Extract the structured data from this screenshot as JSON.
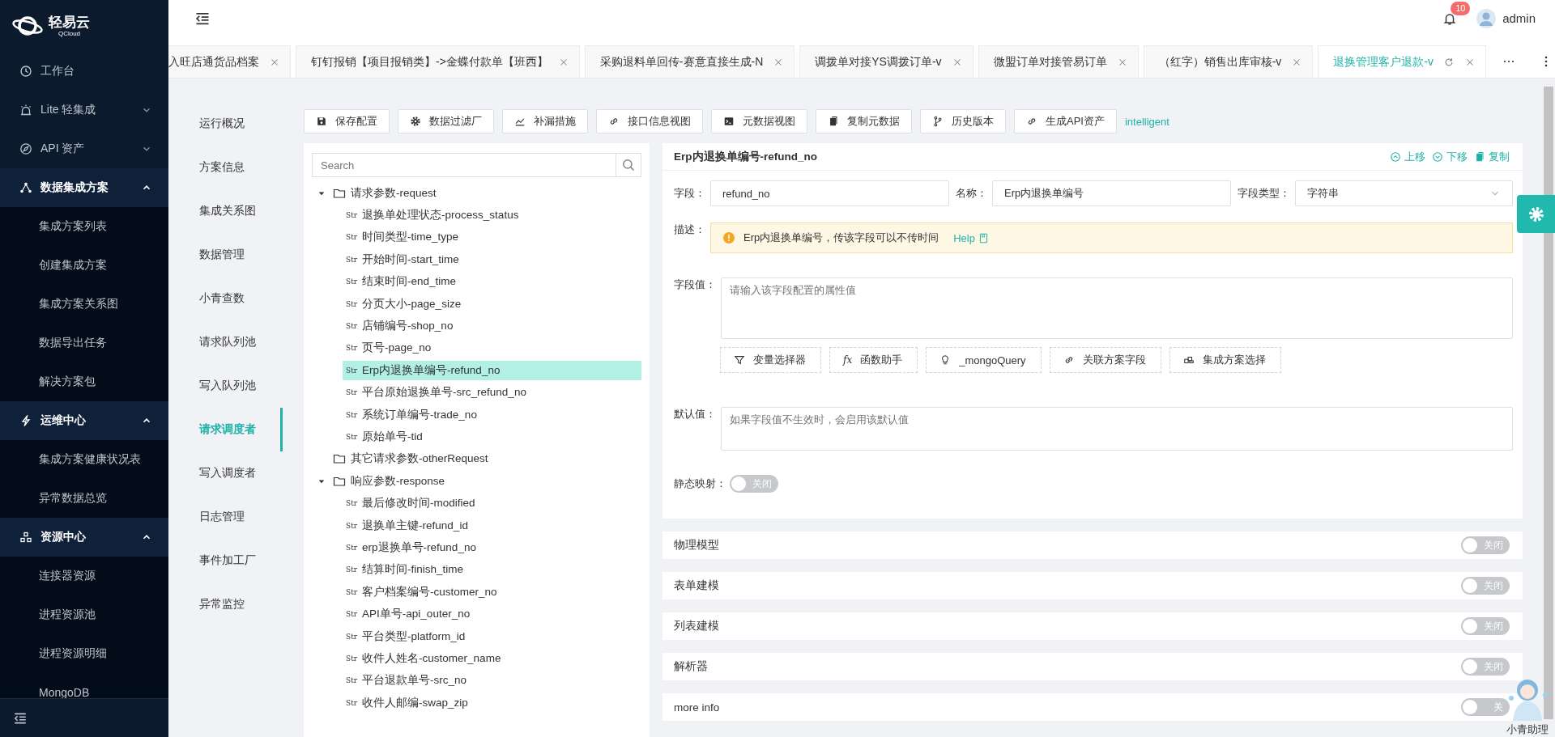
{
  "sidebar": {
    "logo": {
      "title": "轻易云",
      "subtitle": "QCloud"
    },
    "items": [
      {
        "label": "工作台"
      },
      {
        "label": "Lite 轻集成",
        "expanded": false
      },
      {
        "label": "API 资产",
        "expanded": false
      },
      {
        "label": "数据集成方案",
        "expanded": true,
        "children": [
          {
            "label": "集成方案列表"
          },
          {
            "label": "创建集成方案"
          },
          {
            "label": "集成方案关系图"
          },
          {
            "label": "数据导出任务"
          },
          {
            "label": "解决方案包"
          }
        ]
      },
      {
        "label": "运维中心",
        "expanded": true,
        "children": [
          {
            "label": "集成方案健康状况表"
          },
          {
            "label": "异常数据总览"
          }
        ]
      },
      {
        "label": "资源中心",
        "expanded": true,
        "children": [
          {
            "label": "连接器资源"
          },
          {
            "label": "进程资源池"
          },
          {
            "label": "进程资源明细"
          },
          {
            "label": "MongoDB"
          }
        ]
      }
    ]
  },
  "header": {
    "notification_count": "10",
    "user": "admin"
  },
  "tabs": [
    {
      "label": "入旺店通货品档案",
      "selected": false
    },
    {
      "label": "钉钉报销【项目报销类】->金蝶付款单【班西】",
      "selected": false
    },
    {
      "label": "采购退料单回传-赛意直接生成-N",
      "selected": false
    },
    {
      "label": "调拨单对接YS调拨订单-v",
      "selected": false
    },
    {
      "label": "微盟订单对接管易订单",
      "selected": false
    },
    {
      "label": "（红字）销售出库审核-v",
      "selected": false
    },
    {
      "label": "退换管理客户退款-v",
      "selected": true
    }
  ],
  "page_nav": [
    {
      "label": "运行概况",
      "selected": false
    },
    {
      "label": "方案信息",
      "selected": false
    },
    {
      "label": "集成关系图",
      "selected": false
    },
    {
      "label": "数据管理",
      "selected": false
    },
    {
      "label": "小青查数",
      "selected": false
    },
    {
      "label": "请求队列池",
      "selected": false
    },
    {
      "label": "写入队列池",
      "selected": false
    },
    {
      "label": "请求调度者",
      "selected": true
    },
    {
      "label": "写入调度者",
      "selected": false
    },
    {
      "label": "日志管理",
      "selected": false
    },
    {
      "label": "事件加工厂",
      "selected": false
    },
    {
      "label": "异常监控",
      "selected": false
    }
  ],
  "toolbar": {
    "buttons": [
      "保存配置",
      "数据过滤厂",
      "补漏措施",
      "接口信息视图",
      "元数据视图",
      "复制元数据",
      "历史版本",
      "生成API资产"
    ],
    "link": "intelligent"
  },
  "tree": {
    "search_placeholder": "Search",
    "nodes": [
      {
        "label": "请求参数-request",
        "expanded": true,
        "selected": false,
        "children": [
          {
            "type": "Str",
            "label": "退换单处理状态-process_status",
            "selected": false
          },
          {
            "type": "Str",
            "label": "时间类型-time_type",
            "selected": false
          },
          {
            "type": "Str",
            "label": "开始时间-start_time",
            "selected": false
          },
          {
            "type": "Str",
            "label": "结束时间-end_time",
            "selected": false
          },
          {
            "type": "Str",
            "label": "分页大小-page_size",
            "selected": false
          },
          {
            "type": "Str",
            "label": "店铺编号-shop_no",
            "selected": false
          },
          {
            "type": "Str",
            "label": "页号-page_no",
            "selected": false
          },
          {
            "type": "Str",
            "label": "Erp内退换单编号-refund_no",
            "selected": true
          },
          {
            "type": "Str",
            "label": "平台原始退换单号-src_refund_no",
            "selected": false
          },
          {
            "type": "Str",
            "label": "系统订单编号-trade_no",
            "selected": false
          },
          {
            "type": "Str",
            "label": "原始单号-tid",
            "selected": false
          }
        ]
      },
      {
        "label": "其它请求参数-otherRequest",
        "selected": false
      },
      {
        "label": "响应参数-response",
        "expanded": true,
        "selected": false,
        "children": [
          {
            "type": "Str",
            "label": "最后修改时间-modified",
            "selected": false
          },
          {
            "type": "Str",
            "label": "退换单主键-refund_id",
            "selected": false
          },
          {
            "type": "Str",
            "label": "erp退换单号-refund_no",
            "selected": false
          },
          {
            "type": "Str",
            "label": "结算时间-finish_time",
            "selected": false
          },
          {
            "type": "Str",
            "label": "客户档案编号-customer_no",
            "selected": false
          },
          {
            "type": "Str",
            "label": "API单号-api_outer_no",
            "selected": false
          },
          {
            "type": "Str",
            "label": "平台类型-platform_id",
            "selected": false
          },
          {
            "type": "Str",
            "label": "收件人姓名-customer_name",
            "selected": false
          },
          {
            "type": "Str",
            "label": "平台退款单号-src_no",
            "selected": false
          },
          {
            "type": "Str",
            "label": "收件人邮编-swap_zip",
            "selected": false
          }
        ]
      }
    ]
  },
  "detail": {
    "title": "Erp内退换单编号-refund_no",
    "actions": [
      "上移",
      "下移",
      "复制"
    ],
    "fields": [
      {
        "kind": "input",
        "label": "字段：",
        "value": "refund_no"
      },
      {
        "kind": "input",
        "label": "名称：",
        "value": "Erp内退换单编号"
      },
      {
        "kind": "select",
        "label": "字段类型：",
        "value": "字符串"
      }
    ],
    "description": {
      "label": "描述：",
      "text": "Erp内退换单编号，传该字段可以不传时间",
      "link": "Help"
    },
    "value": {
      "label": "字段值：",
      "placeholder": "请输入该字段配置的属性值"
    },
    "helpers": [
      {
        "label": "变量选择器"
      },
      {
        "label": "函数助手",
        "glyph": "fx"
      },
      {
        "label": "_mongoQuery"
      },
      {
        "label": "关联方案字段"
      },
      {
        "label": "集成方案选择"
      }
    ],
    "default": {
      "label": "默认值：",
      "placeholder": "如果字段值不生效时，会启用该默认值"
    },
    "static_mapping": {
      "label": "静态映射：",
      "on": false,
      "toggle_label": "关闭"
    }
  },
  "sections": [
    {
      "title": "物理模型",
      "on": false,
      "toggle_label": "关闭"
    },
    {
      "title": "表单建模",
      "on": false,
      "toggle_label": "关闭"
    },
    {
      "title": "列表建模",
      "on": false,
      "toggle_label": "关闭"
    },
    {
      "title": "解析器",
      "on": false,
      "toggle_label": "关闭"
    },
    {
      "title": "more info",
      "on": false,
      "toggle_label": "关"
    }
  ],
  "assistant": {
    "label": "小青助理"
  }
}
